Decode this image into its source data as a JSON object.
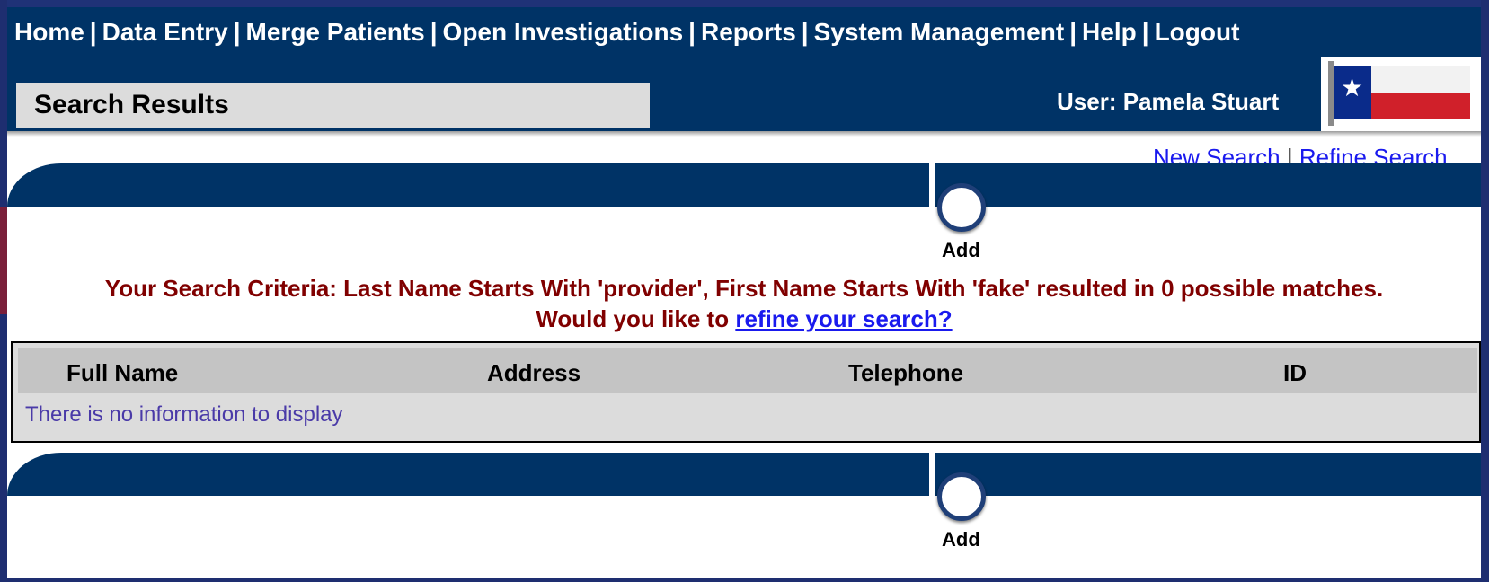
{
  "nav": {
    "items": [
      "Home",
      "Data Entry",
      "Merge Patients",
      "Open Investigations",
      "Reports",
      "System Management",
      "Help",
      "Logout"
    ],
    "separator": "|"
  },
  "page": {
    "title": "Search Results"
  },
  "user": {
    "label": "User: Pamela Stuart"
  },
  "search_links": {
    "new_search": "New Search",
    "separator": "|",
    "refine_search": "Refine Search"
  },
  "add": {
    "label": "Add"
  },
  "criteria": {
    "message": "Your Search Criteria: Last Name Starts With 'provider', First Name Starts With 'fake' resulted in 0 possible matches.",
    "prompt": "Would you like to",
    "refine_link": "refine your search?"
  },
  "table": {
    "headers": [
      "Full Name",
      "Address",
      "Telephone",
      "ID"
    ],
    "empty_message": "There is no information to display"
  },
  "colors": {
    "navy": "#003366",
    "criteria_red": "#800000",
    "link_blue": "#1a1aee",
    "table_gray": "#dcdcdc",
    "header_gray": "#c4c4c4"
  },
  "icons": {
    "flag": "texas-flag-icon",
    "add": "add-circle-icon"
  }
}
